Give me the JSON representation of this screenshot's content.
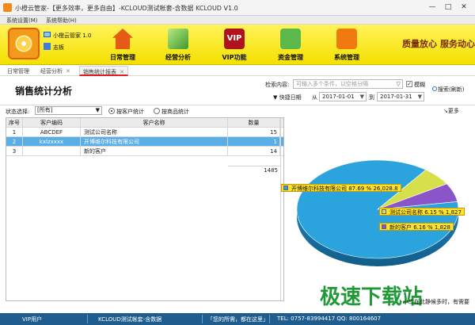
{
  "window": {
    "title": "小橙云管家-【更多效率，更多自由】-KCLOUD测试帐套-含数据  KCLOUD V1.0",
    "min_glyph": "—",
    "max_glyph": "□",
    "close_glyph": "✕"
  },
  "menu": [
    "系统设置(M)",
    "系统帮助(H)"
  ],
  "user": {
    "name": "小橙云管家 1.0",
    "board": "志板"
  },
  "toolbar": [
    {
      "label": "日常管理",
      "icon": "home-icon"
    },
    {
      "label": "经营分析",
      "icon": "area-chart-icon"
    },
    {
      "label": "VIP功能",
      "icon": "vip-icon",
      "icon_text": "VIP"
    },
    {
      "label": "资金管理",
      "icon": "money-icon"
    },
    {
      "label": "系统管理",
      "icon": "settings-icon"
    }
  ],
  "slogans": [
    "质量放心",
    "服务动心"
  ],
  "tabs": [
    {
      "label": "日常管理"
    },
    {
      "label": "经营分析",
      "close": "✕"
    },
    {
      "label": "销售统计报表",
      "close": "✕",
      "active": true
    }
  ],
  "page_title": "销售统计分析",
  "search": {
    "label": "检索内容:",
    "placeholder": "可输入多个条件，以空格分隔",
    "dropdown_glyph": "▽",
    "fuzzy_checked": "✓",
    "fuzzy_label": "模糊",
    "button_label": "搜索(刷新)"
  },
  "date_filter": {
    "quick_label": "▼ 快捷日期",
    "from_label": "从",
    "from": "2017-01-01",
    "to_label": "到",
    "to": "2017-01-31",
    "dropdown_glyph": "▼"
  },
  "filters": {
    "status_label": "状态选择:",
    "status_value": "[所有]",
    "status_glyph": "▼",
    "radios": [
      {
        "label": "按客户统计",
        "selected": true
      },
      {
        "label": "按商品统计",
        "selected": false
      }
    ],
    "more_label": "更多"
  },
  "table": {
    "headers": [
      "序号",
      "客户编码",
      "客户名称",
      "数量"
    ],
    "rows": [
      [
        "1",
        "ABCDEF",
        "测试公司名称",
        "15"
      ],
      [
        "2",
        "kxlzxxxx",
        "开博维尔科技有限公司",
        "1"
      ],
      [
        "3",
        "",
        "新的客户",
        "14"
      ]
    ],
    "total": "1485"
  },
  "chart_data": {
    "type": "pie",
    "slices": [
      {
        "name": "开博维尔科技有限公司",
        "percent": 87.69,
        "value": 26028.8,
        "label": "开博维尔科技有限公司 87.69 % 26,028.8",
        "color": "#2ba3dc"
      },
      {
        "name": "测试公司名称",
        "percent": 6.15,
        "value": 1827,
        "label": "测试公司名称 6.15 % 1,827",
        "color": "#d6e04a"
      },
      {
        "name": "新的客户",
        "percent": 6.16,
        "value": 1828,
        "label": "新的客户 6.16 % 1,828",
        "color": "#8a55c8"
      }
    ]
  },
  "hint": "小二在此静候多时，有需要",
  "watermark": "极速下载站",
  "statusbar": [
    "VIP用户",
    "KCLOUD测试帐套-含数据",
    "「您的所需，都在这里」",
    "TEL: 0757-83994417  QQ: 800164607"
  ]
}
